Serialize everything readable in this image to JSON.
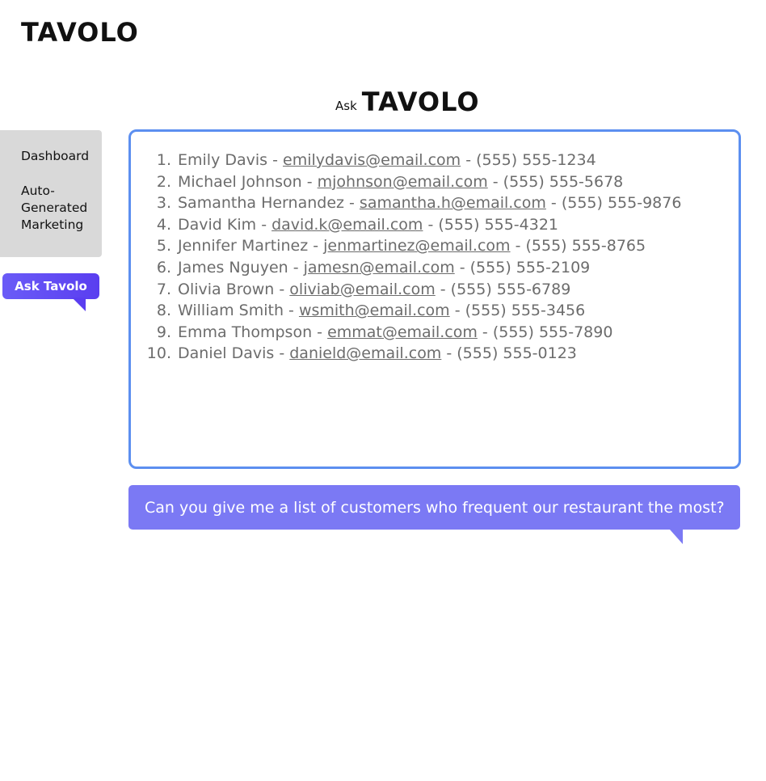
{
  "brand": {
    "logo_text": "TAVOLO",
    "ask_prefix": "Ask"
  },
  "sidebar": {
    "items": [
      {
        "label": "Dashboard"
      },
      {
        "label": "Auto-Generated Marketing"
      }
    ]
  },
  "ask_button": {
    "label": "Ask Tavolo"
  },
  "response": {
    "customers": [
      {
        "num": "1.",
        "name": "Emily Davis",
        "email": "emilydavis@email.com",
        "phone": "(555) 555-1234"
      },
      {
        "num": "2.",
        "name": "Michael Johnson",
        "email": "mjohnson@email.com",
        "phone": "(555) 555-5678"
      },
      {
        "num": "3.",
        "name": "Samantha Hernandez",
        "email": "samantha.h@email.com",
        "phone": "(555) 555-9876"
      },
      {
        "num": "4.",
        "name": "David Kim",
        "email": "david.k@email.com",
        "phone": "(555) 555-4321"
      },
      {
        "num": "5.",
        "name": "Jennifer Martinez",
        "email": "jenmartinez@email.com",
        "phone": "(555) 555-8765"
      },
      {
        "num": "6.",
        "name": "James Nguyen",
        "email": "jamesn@email.com",
        "phone": "(555) 555-2109"
      },
      {
        "num": "7.",
        "name": "Olivia Brown",
        "email": "oliviab@email.com",
        "phone": "(555) 555-6789"
      },
      {
        "num": "8.",
        "name": "William Smith",
        "email": "wsmith@email.com",
        "phone": "(555) 555-3456"
      },
      {
        "num": "9.",
        "name": "Emma Thompson",
        "email": "emmat@email.com",
        "phone": "(555) 555-7890"
      },
      {
        "num": "10.",
        "name": "Daniel Davis",
        "email": "danield@email.com",
        "phone": "(555) 555-0123"
      }
    ],
    "separator": " - "
  },
  "question": {
    "text": "Can you give me a list of customers who frequent our restaurant the most?"
  },
  "colors": {
    "accent": "#5a3ef0",
    "bubble": "#7b79f4",
    "box_border": "#5c8ff0",
    "sidebar_bg": "#d9d9d9"
  }
}
